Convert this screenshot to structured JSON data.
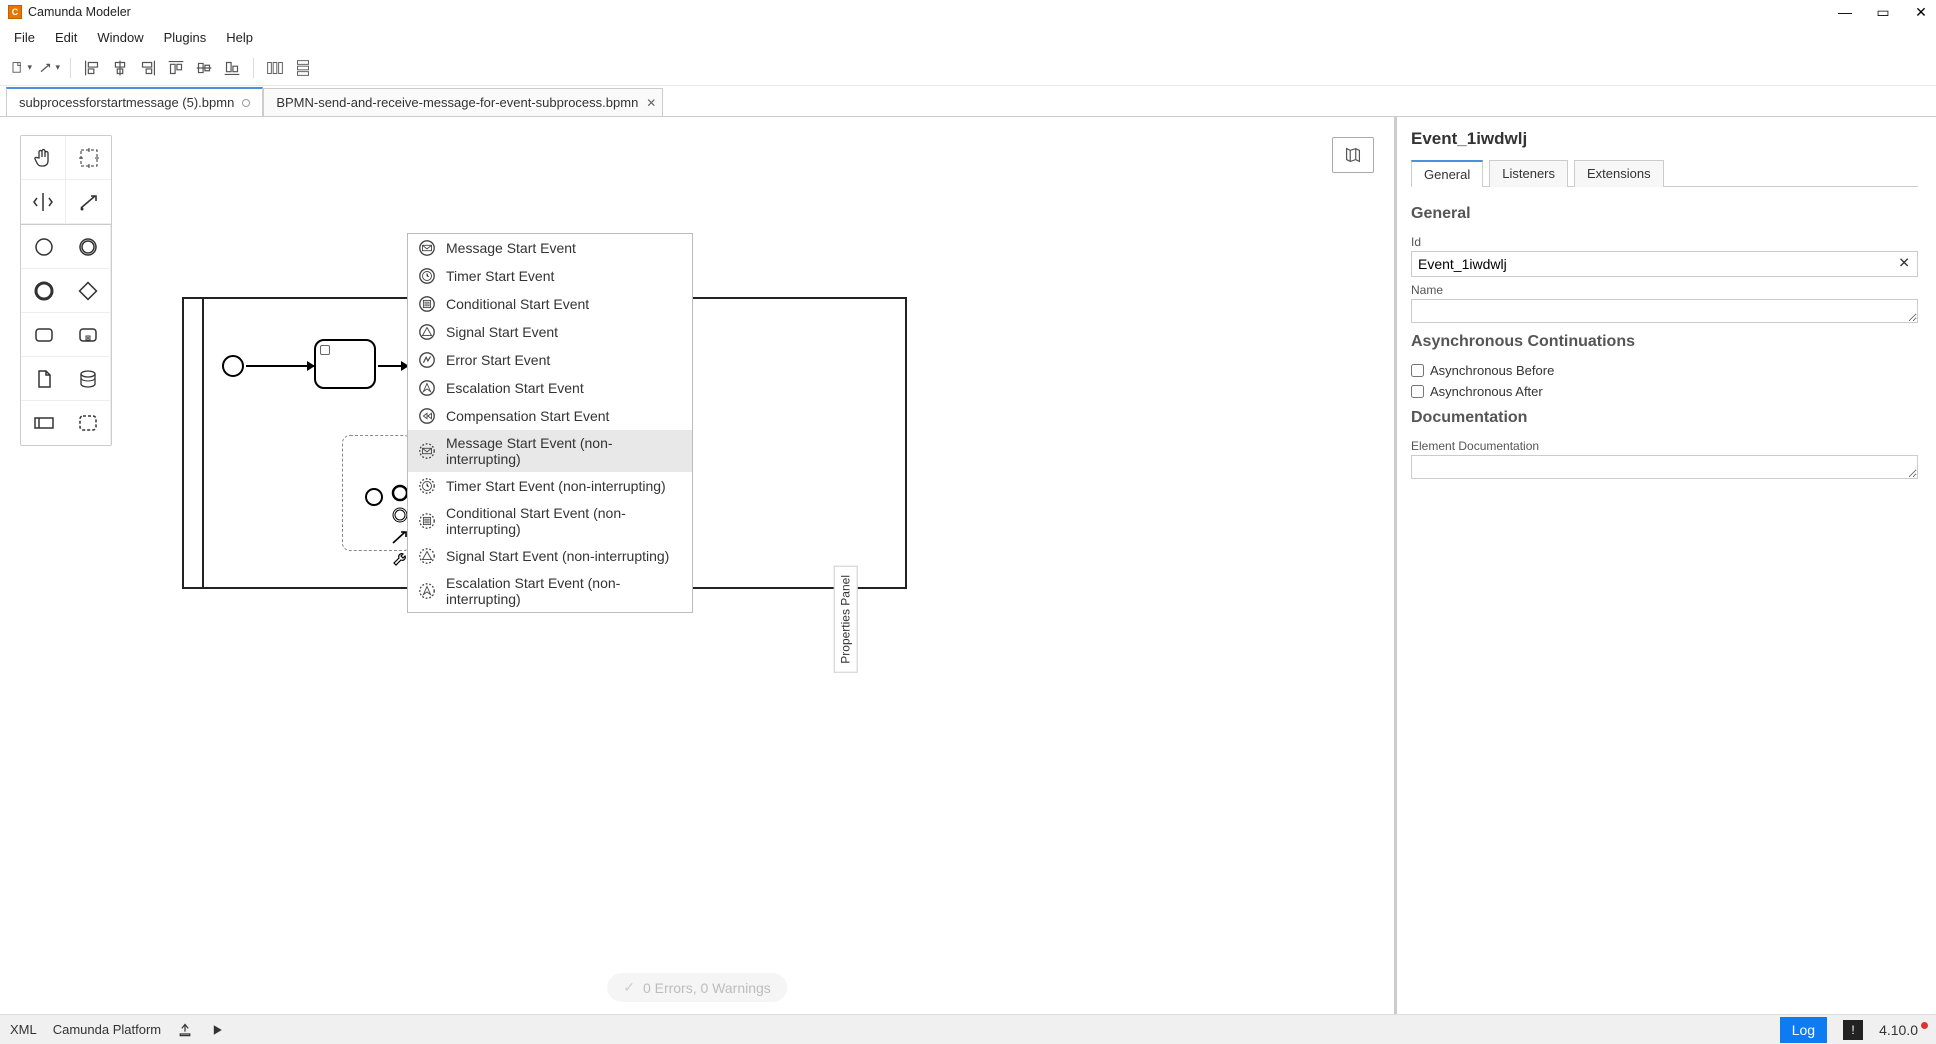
{
  "app": {
    "title": "Camunda Modeler"
  },
  "menu": {
    "items": [
      "File",
      "Edit",
      "Window",
      "Plugins",
      "Help"
    ]
  },
  "tabs": [
    {
      "label": "subprocessforstartmessage (5).bpmn",
      "active": true,
      "unsaved": true
    },
    {
      "label": "BPMN-send-and-receive-message-for-event-subprocess.bpmn",
      "active": false,
      "closable": true
    }
  ],
  "palette_tooltips": [
    "hand-tool",
    "lasso-tool",
    "space-tool",
    "global-connect",
    "start-event",
    "intermediate-event",
    "end-event",
    "gateway",
    "task",
    "subprocess",
    "data-object",
    "data-store",
    "participant",
    "group"
  ],
  "event_menu": {
    "items": [
      "Message Start Event",
      "Timer Start Event",
      "Conditional Start Event",
      "Signal Start Event",
      "Error Start Event",
      "Escalation Start Event",
      "Compensation Start Event",
      "Message Start Event (non-interrupting)",
      "Timer Start Event (non-interrupting)",
      "Conditional Start Event (non-interrupting)",
      "Signal Start Event (non-interrupting)",
      "Escalation Start Event (non-interrupting)"
    ],
    "selected_index": 7
  },
  "status": {
    "text": "0 Errors, 0 Warnings"
  },
  "properties": {
    "panel_label": "Properties Panel",
    "element_name": "Event_1iwdwlj",
    "tabs": [
      "General",
      "Listeners",
      "Extensions"
    ],
    "active_tab": 0,
    "sections": {
      "general": {
        "title": "General",
        "id_label": "Id",
        "id_value": "Event_1iwdwlj",
        "name_label": "Name",
        "name_value": ""
      },
      "async": {
        "title": "Asynchronous Continuations",
        "before_label": "Asynchronous Before",
        "before_checked": false,
        "after_label": "Asynchronous After",
        "after_checked": false
      },
      "doc": {
        "title": "Documentation",
        "elem_doc_label": "Element Documentation",
        "elem_doc_value": ""
      }
    }
  },
  "bottom": {
    "xml": "XML",
    "platform": "Camunda Platform",
    "log": "Log",
    "version": "4.10.0"
  }
}
